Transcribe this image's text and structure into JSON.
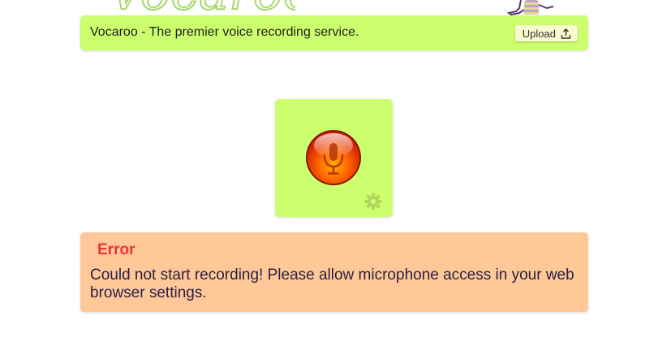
{
  "header": {
    "logo_text": "Vocaroo",
    "tagline": "Vocaroo - The premier voice recording service.",
    "upload_label": "Upload",
    "upload_icon": "upload-icon"
  },
  "recorder": {
    "record_icon": "microphone-icon",
    "settings_icon": "gear-icon"
  },
  "error": {
    "title": "Error",
    "message": "Could not start recording! Please allow microphone access in your web browser settings."
  },
  "colors": {
    "panel_green": "#ccff6e",
    "error_bg": "#ffc899",
    "error_title": "#ee3333",
    "record_red": "#e02800",
    "record_orange": "#ff8a00"
  }
}
